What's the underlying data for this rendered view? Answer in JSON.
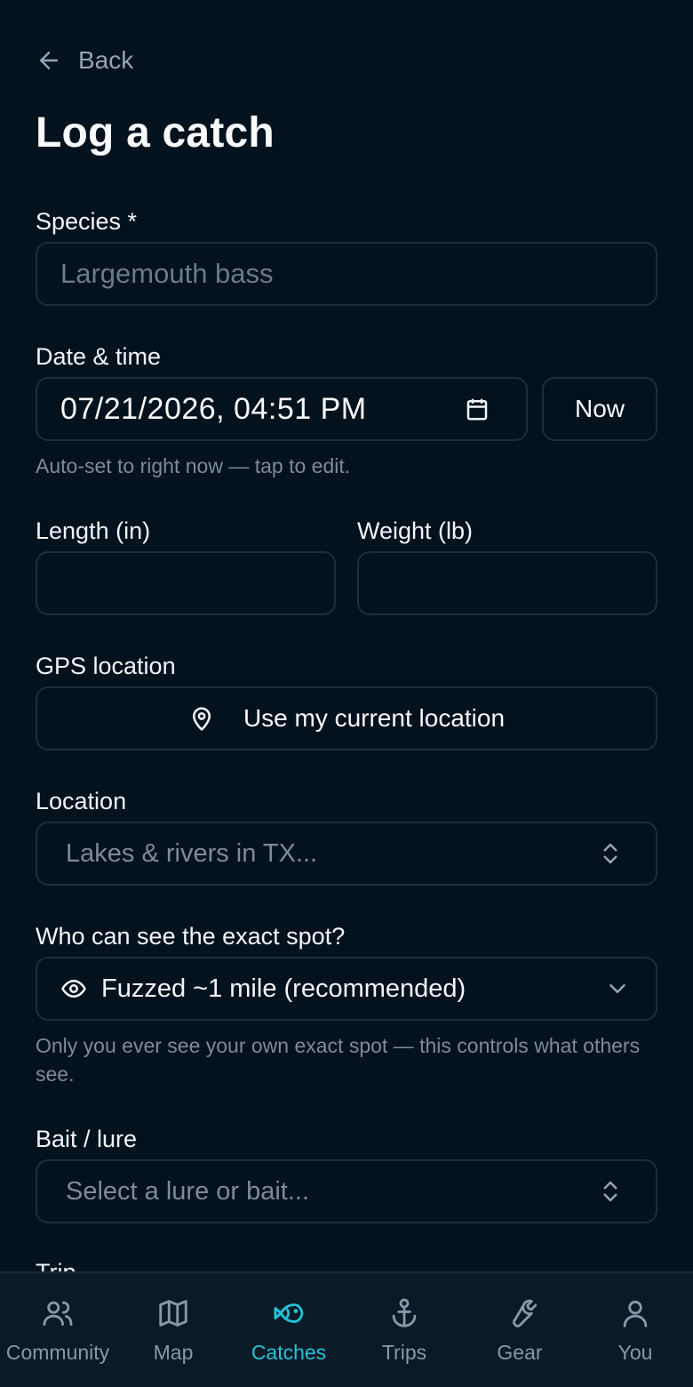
{
  "header": {
    "back_label": "Back",
    "title": "Log a catch"
  },
  "form": {
    "species": {
      "label": "Species *",
      "placeholder": "Largemouth bass",
      "value": ""
    },
    "datetime": {
      "label": "Date & time",
      "value": "07/21/2026, 04:51 PM",
      "now_label": "Now",
      "hint": "Auto-set to right now — tap to edit."
    },
    "length": {
      "label": "Length (in)",
      "value": ""
    },
    "weight": {
      "label": "Weight (lb)",
      "value": ""
    },
    "gps": {
      "label": "GPS location",
      "button_label": "Use my current location"
    },
    "location": {
      "label": "Location",
      "placeholder": "Lakes & rivers in TX..."
    },
    "visibility": {
      "label": "Who can see the exact spot?",
      "selected": "Fuzzed ~1 mile (recommended)",
      "hint": "Only you ever see your own exact spot — this controls what others see."
    },
    "bait": {
      "label": "Bait / lure",
      "placeholder": "Select a lure or bait..."
    },
    "trip": {
      "label": "Trip"
    }
  },
  "tabbar": {
    "active": "Catches",
    "active_color": "#22c4d8",
    "items": [
      {
        "label": "Community",
        "icon": "users-icon"
      },
      {
        "label": "Map",
        "icon": "map-icon"
      },
      {
        "label": "Catches",
        "icon": "fish-icon"
      },
      {
        "label": "Trips",
        "icon": "anchor-icon"
      },
      {
        "label": "Gear",
        "icon": "wrench-icon"
      },
      {
        "label": "You",
        "icon": "user-icon"
      }
    ]
  }
}
